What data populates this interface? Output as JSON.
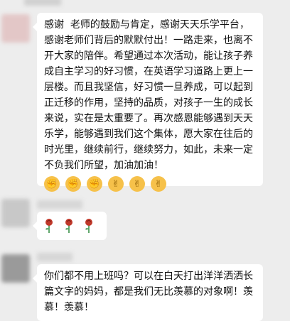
{
  "message1": {
    "text": "感谢  老师的鼓励与肯定，感谢天天乐学平台，感谢老师们背后的默默付出！一路走来，也离不开大家的陪伴。希望通过本次活动，能让孩子养成自主学习的好习惯，在英语学习道路上更上一层楼。而且我坚信，好习惯一旦养成，可以起到正迁移的作用，坚持的品质，对孩子一生的成长来说，实在是太重要了。再次感恩能够遇到天天乐学，能够遇到我们这个集体，愿大家在往后的时光里，继续前行，继续努力，如此，未来一定不负我们所望，加油加油！",
    "emojis": [
      "fist-icon",
      "fist-icon",
      "fist-icon",
      "victory-hand-icon",
      "victory-hand-icon",
      "victory-hand-icon"
    ],
    "emoji_glyphs": {
      "fist-icon": "✊",
      "victory-hand-icon": "✌"
    }
  },
  "message2": {
    "emojis": [
      "rose-icon",
      "rose-icon",
      "rose-icon"
    ]
  },
  "message3": {
    "text": "你们都不用上班吗？可以在白天打出洋洋洒洒长篇文字的妈妈，都是我们无比羡慕的对象啊！羡慕！羡慕！"
  },
  "colors": {
    "background": "#ededed",
    "bubble": "#ffffff",
    "rose": "#c0392b",
    "stem": "#2e8b3d"
  }
}
